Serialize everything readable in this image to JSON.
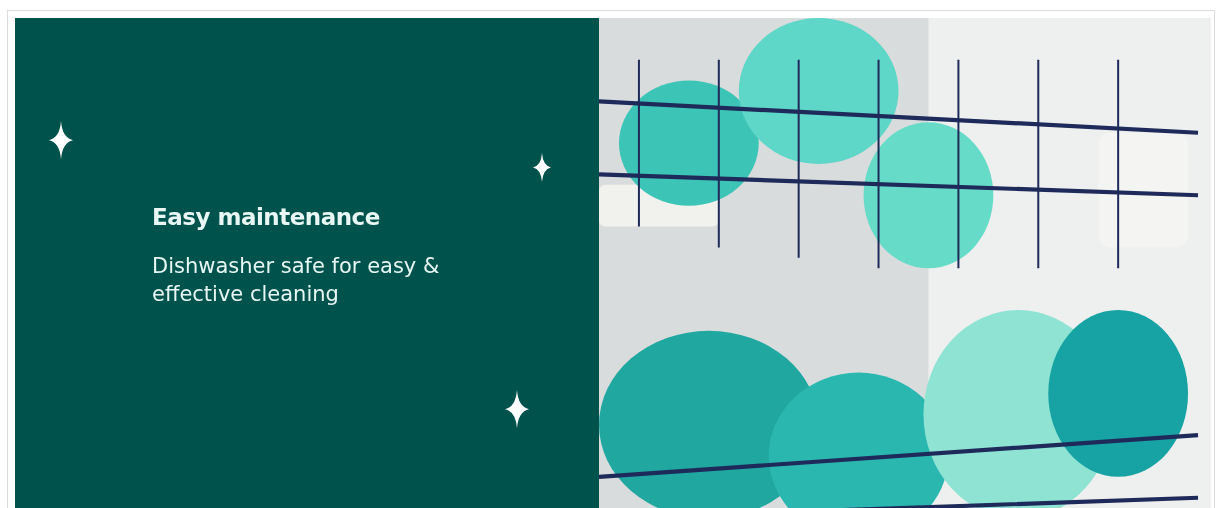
{
  "banner": {
    "heading": "Easy maintenance",
    "text": "Dishwasher safe for easy & effective cleaning"
  }
}
